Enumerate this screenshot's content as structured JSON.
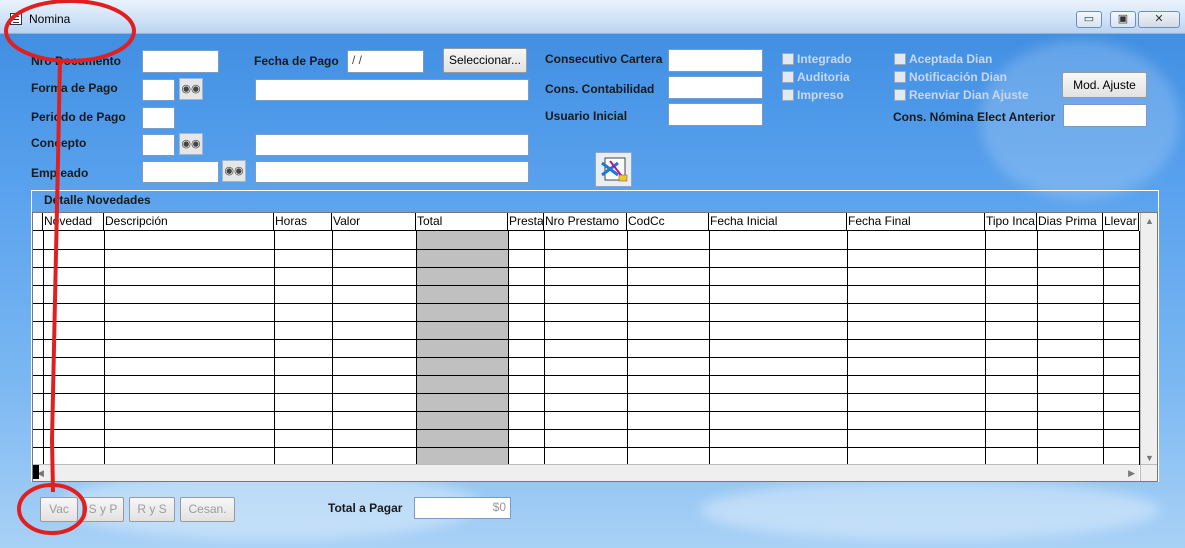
{
  "window": {
    "title": "Nomina",
    "buttons": {
      "minimize": "▭",
      "maximize": "▣",
      "close": "✕"
    }
  },
  "form": {
    "labels": {
      "nro_documento": "Nro Documento",
      "forma_de_pago": "Forma de Pago",
      "periodo_de_pago": "Periodo de Pago",
      "concepto": "Concepto",
      "empleado": "Empleado",
      "fecha_de_pago": "Fecha de Pago",
      "consecutivo_cartera": "Consecutivo Cartera",
      "cons_contabilidad": "Cons. Contabilidad",
      "usuario_inicial": "Usuario Inicial",
      "cons_nomina_elect_anterior": "Cons. Nómina Elect Anterior"
    },
    "values": {
      "fecha_de_pago": " / /"
    },
    "buttons": {
      "seleccionar": "Seleccionar...",
      "mod_ajuste": "Mod. Ajuste"
    },
    "checkboxes": {
      "integrado": "Integrado",
      "auditoria": "Auditoria",
      "impreso": "Impreso",
      "aceptada_dian": "Aceptada Dian",
      "notificacion_dian": "Notificación Dian",
      "reenviar_dian_ajuste": "Reenviar Dian Ajuste"
    }
  },
  "grid": {
    "caption": "Detalle Novedades",
    "columns": [
      "Novedad",
      "Descripción",
      "Horas",
      "Valor",
      "Total",
      "Presta",
      "Nro Prestamo",
      "CodCc",
      "Fecha Inicial",
      "Fecha Final",
      "Tipo Inca",
      "Dias Prima",
      "Llevar"
    ]
  },
  "footer": {
    "buttons": [
      "Vac",
      "S y P",
      "R y S",
      "Cesan."
    ],
    "total_label": "Total a Pagar",
    "total_value": "$0"
  },
  "colors": {
    "annotation": "#e02020",
    "total_column": "#c0c0c0"
  }
}
